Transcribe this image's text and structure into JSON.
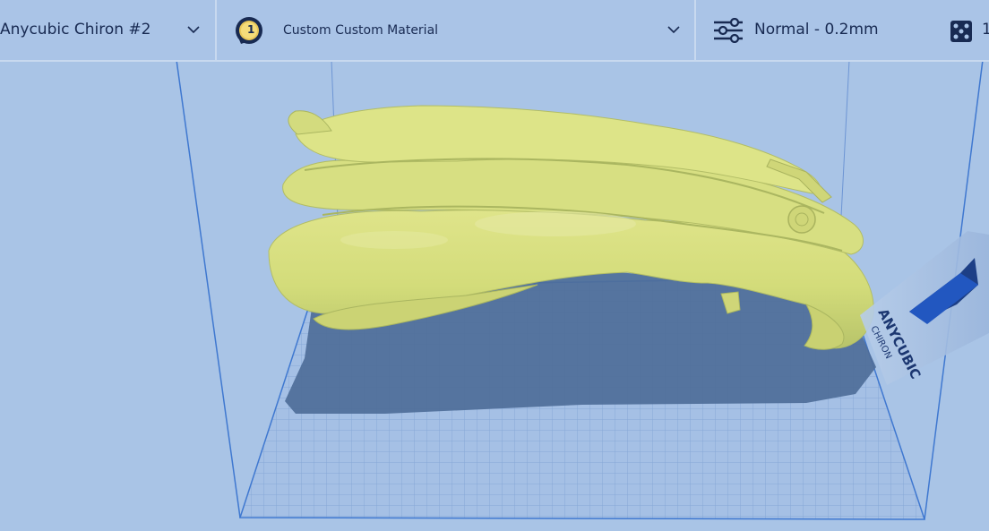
{
  "toolbar": {
    "printer": {
      "label": "Anycubic Chiron #2",
      "icon": "chevron-down-icon"
    },
    "material": {
      "extruder_number": "1",
      "label": "Custom Custom Material",
      "icon": "chevron-down-icon"
    },
    "profile": {
      "label": "Normal - 0.2mm",
      "icon": "sliders-icon"
    },
    "support": {
      "icon": "support-pattern-icon",
      "value": "1"
    }
  },
  "build_plate": {
    "logo_brand": "ANYCUBIC",
    "logo_model": "CHIRON"
  },
  "colors": {
    "background": "#a9c4e6",
    "model": "#d8e07f",
    "accent": "#182a52",
    "plate_grid": "#8aaad8",
    "shadow": "#4e6e99",
    "ext_badge_ring": "#e8c85a"
  }
}
